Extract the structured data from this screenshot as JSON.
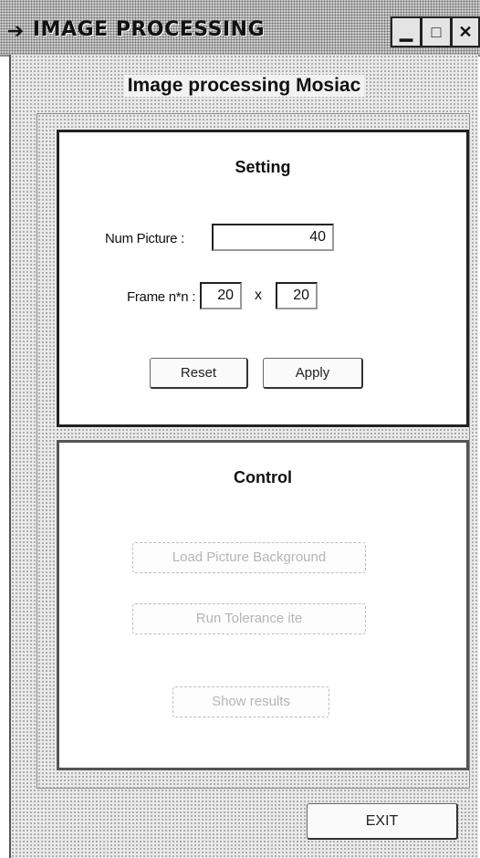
{
  "window": {
    "title": "IMAGE PROCESSING",
    "app_icon": "arrow-app-icon",
    "controls": {
      "minimize_icon": "minimize-icon",
      "maximize_icon": "maximize-icon",
      "close_icon": "close-icon"
    }
  },
  "heading": "Image processing Mosiac",
  "setting": {
    "title": "Setting",
    "num_picture_label": "Num Picture :",
    "num_picture_value": "40",
    "frame_label": "Frame n*n :",
    "frame_width_value": "20",
    "frame_times": "x",
    "frame_height_value": "20",
    "reset_label": "Reset",
    "apply_label": "Apply"
  },
  "control": {
    "title": "Control",
    "load_background_label": "Load Picture Background",
    "run_label": "Run Tolerance ite",
    "show_results_label": "Show results"
  },
  "exit_label": "EXIT",
  "colors": {
    "panel_border": "#222222",
    "disabled_text": "#b5b5b5",
    "background_texture": "#e9e9e9"
  }
}
